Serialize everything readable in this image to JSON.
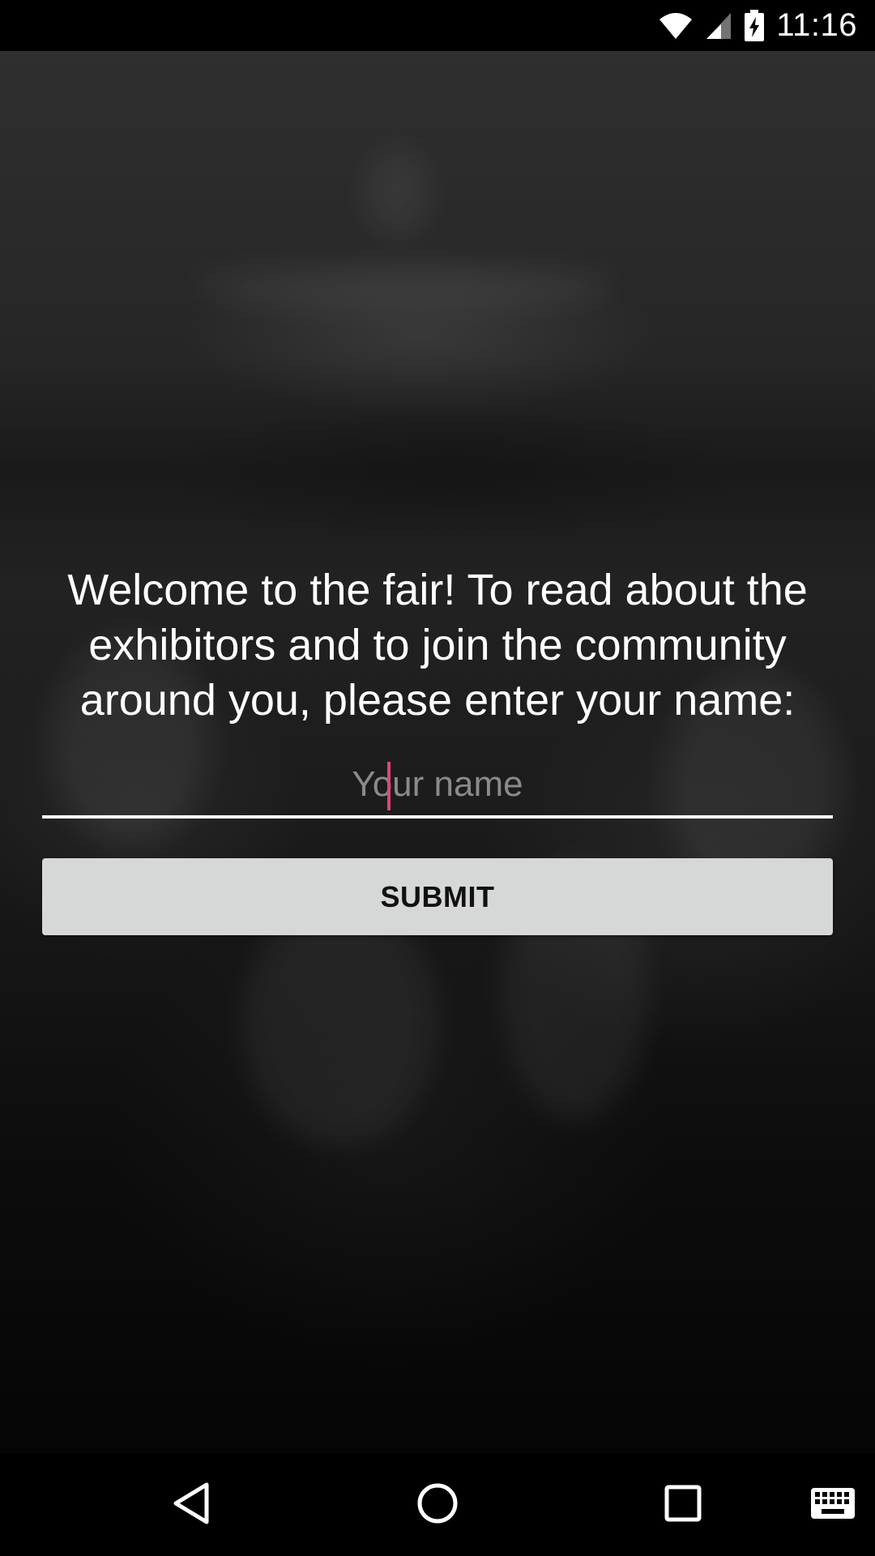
{
  "status_bar": {
    "time": "11:16",
    "icons": [
      "wifi-icon",
      "cell-signal-icon",
      "battery-charging-icon"
    ]
  },
  "main": {
    "welcome_text": "Welcome to the fair! To read about the exhibitors and to join the community around you, please enter your name:",
    "name_input": {
      "placeholder": "Your name",
      "value": ""
    },
    "submit_label": "SUBMIT"
  },
  "nav_bar": {
    "buttons": [
      "back-icon",
      "home-icon",
      "recents-icon",
      "keyboard-icon"
    ]
  },
  "colors": {
    "accent": "#e0447a",
    "button_bg": "#d6d7d7",
    "status_bar_bg": "#000000"
  }
}
